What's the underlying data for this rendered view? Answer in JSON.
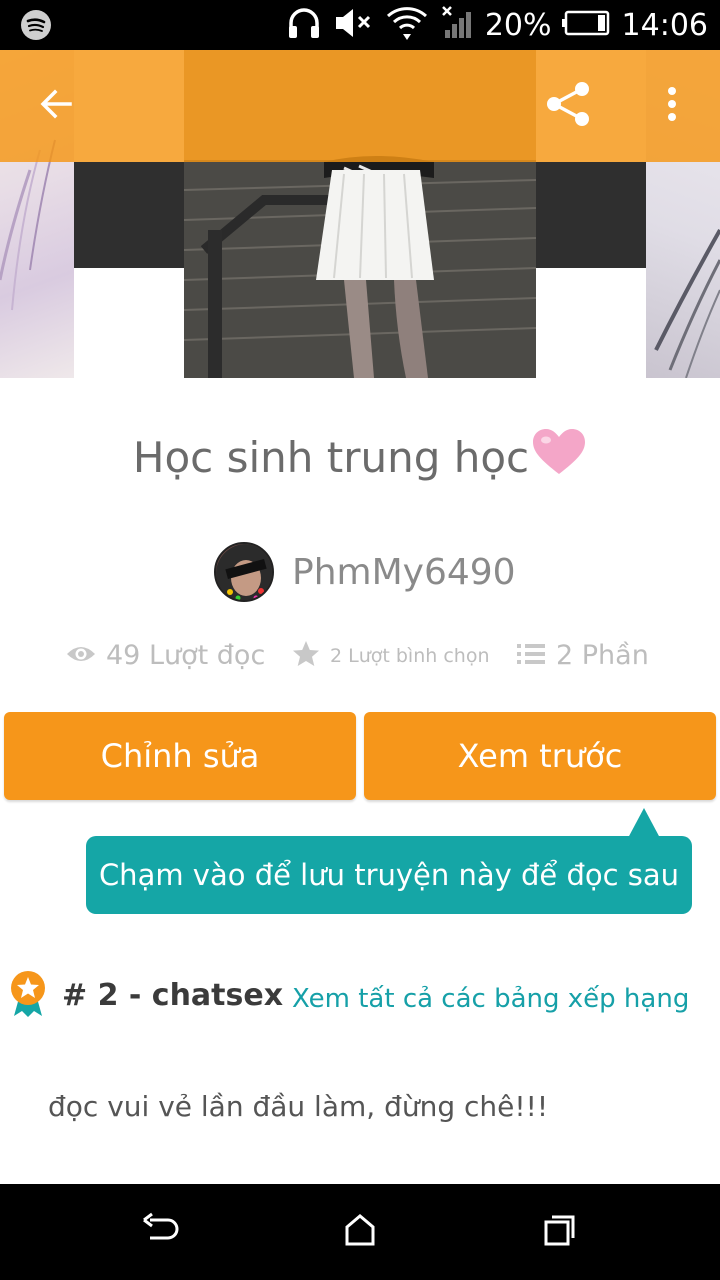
{
  "status_bar": {
    "battery_text": "20%",
    "time": "14:06"
  },
  "story": {
    "title": "Học sinh trung học",
    "title_emoji": "heart-emoji",
    "author": "PhmMy6490",
    "reads": "49 Lượt đọc",
    "votes": "2 Lượt bình chọn",
    "parts": "2 Phần",
    "edit_button": "Chỉnh sửa",
    "preview_button": "Xem trước",
    "tooltip": "Chạm vào để lưu truyện này để đọc sau",
    "rank_label": "# 2 - chatsex",
    "rank_link": "Xem tất cả các bảng xếp hạng",
    "description": "đọc vui vẻ lần đầu làm, đừng chê!!!"
  },
  "colors": {
    "accent": "#f6961a",
    "teal": "#15a6a6"
  }
}
